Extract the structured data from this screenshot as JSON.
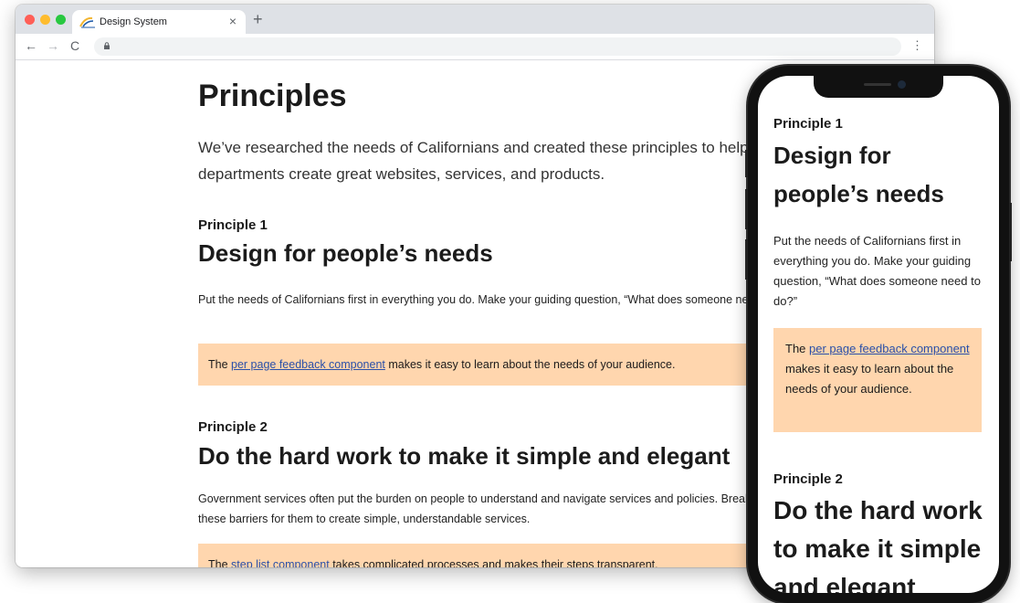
{
  "browser": {
    "tab_title": "Design System",
    "tab_close": "×",
    "new_tab": "+",
    "back": "←",
    "forward": "→",
    "reload": "C",
    "menu": "⋮"
  },
  "desktop": {
    "title": "Principles",
    "lead": "We’ve researched the needs of Californians and created these principles to help state departments create great websites, services, and products.",
    "principles": [
      {
        "kicker": "Principle 1",
        "heading": "Design for people’s needs",
        "text": "Put the needs of Californians first in everything you do. Make your guiding question, “What does someone need to do?”",
        "callout_prefix": "The ",
        "callout_link": "per page feedback component",
        "callout_suffix": " makes it easy to learn about the needs of your audience."
      },
      {
        "kicker": "Principle 2",
        "heading": "Do the hard work to make it simple and elegant",
        "text": "Government services often put the burden on people to understand and navigate services and policies. Break down these barriers for them to create simple, understandable services.",
        "callout_prefix": "The ",
        "callout_link": "step list component",
        "callout_suffix": " takes complicated processes and makes their steps transparent."
      }
    ]
  },
  "mobile": {
    "kicker": "Principle 1",
    "heading": "Design for people’s needs",
    "text": "Put the needs of Californians first in everything you do. Make your guiding question, “What does someone need to do?”",
    "callout_prefix": "The ",
    "callout_link": "per page feedback component",
    "callout_suffix": " makes it easy to learn about the needs of your audience.",
    "kicker2": "Principle 2",
    "heading2": "Do the hard work to make it simple and elegant"
  },
  "colors": {
    "callout_bg": "#ffd6ae",
    "link": "#2a50a8",
    "chrome_tabbar": "#dee1e6"
  },
  "icons": [
    "ca-logo-icon",
    "close-icon",
    "plus-icon",
    "back-arrow-icon",
    "forward-arrow-icon",
    "reload-icon",
    "lock-icon",
    "kebab-menu-icon"
  ]
}
